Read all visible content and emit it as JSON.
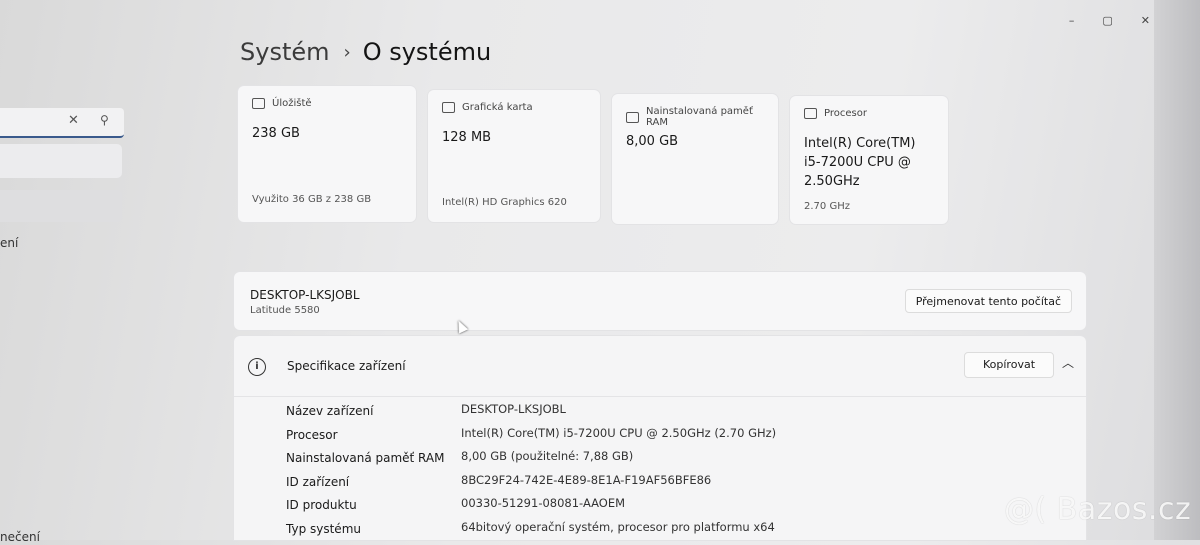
{
  "window_controls": {
    "minimize": "–",
    "maximize": "▢",
    "close": "✕"
  },
  "sidebar": {
    "fragment_1": "ení",
    "fragment_2": "nečení"
  },
  "breadcrumb": {
    "parent": "Systém",
    "current": "O systému"
  },
  "cards": [
    {
      "label": "Úložiště",
      "value": "238 GB",
      "sub": "Využito 36 GB z 238 GB"
    },
    {
      "label": "Grafická karta",
      "value": "128 MB",
      "sub": "Intel(R) HD Graphics 620"
    },
    {
      "label": "Nainstalovaná paměť RAM",
      "value": "8,00 GB",
      "sub": ""
    },
    {
      "label": "Procesor",
      "value": "Intel(R) Core(TM) i5-7200U CPU @ 2.50GHz",
      "sub": "2.70 GHz"
    }
  ],
  "device": {
    "name": "DESKTOP-LKSJOBL",
    "model": "Latitude 5580",
    "rename_label": "Přejmenovat tento počítač"
  },
  "spec": {
    "title": "Specifikace zařízení",
    "copy_label": "Kopírovat",
    "rows": [
      {
        "key": "Název zařízení",
        "value": "DESKTOP-LKSJOBL"
      },
      {
        "key": "Procesor",
        "value": "Intel(R) Core(TM) i5-7200U CPU @ 2.50GHz (2.70 GHz)"
      },
      {
        "key": "Nainstalovaná paměť RAM",
        "value": "8,00 GB (použitelné: 7,88 GB)"
      },
      {
        "key": "ID zařízení",
        "value": "8BC29F24-742E-4E89-8E1A-F19AF56BFE86"
      },
      {
        "key": "ID produktu",
        "value": "00330-51291-08081-AAOEM"
      },
      {
        "key": "Typ systému",
        "value": "64bitový operační systém, procesor pro platformu x64"
      }
    ]
  },
  "watermark": "@( Bazos.cz"
}
